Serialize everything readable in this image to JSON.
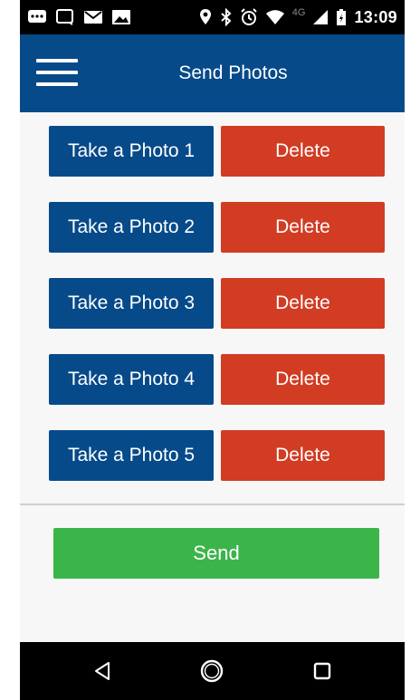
{
  "status_bar": {
    "network_type": "4G",
    "time": "13:09",
    "left_icons": [
      "chat-bubble-icon",
      "message-square-icon",
      "mail-icon",
      "image-icon"
    ],
    "right_icons": [
      "location-pin-icon",
      "bluetooth-icon",
      "alarm-clock-icon",
      "wifi-icon",
      "cell-signal-icon",
      "battery-charging-icon"
    ]
  },
  "header": {
    "title": "Send Photos",
    "menu_icon": "hamburger-menu-icon"
  },
  "photo_rows": [
    {
      "take_label": "Take a Photo 1",
      "delete_label": "Delete"
    },
    {
      "take_label": "Take a Photo 2",
      "delete_label": "Delete"
    },
    {
      "take_label": "Take a Photo 3",
      "delete_label": "Delete"
    },
    {
      "take_label": "Take a Photo 4",
      "delete_label": "Delete"
    },
    {
      "take_label": "Take a Photo 5",
      "delete_label": "Delete"
    }
  ],
  "send": {
    "label": "Send"
  },
  "nav_bar": {
    "icons": [
      "back-triangle-icon",
      "home-circle-icon",
      "recents-square-icon"
    ]
  },
  "colors": {
    "primary_blue": "#064a8a",
    "delete_red": "#d13c23",
    "send_green": "#3bb54a",
    "background": "#f7f7f7"
  }
}
